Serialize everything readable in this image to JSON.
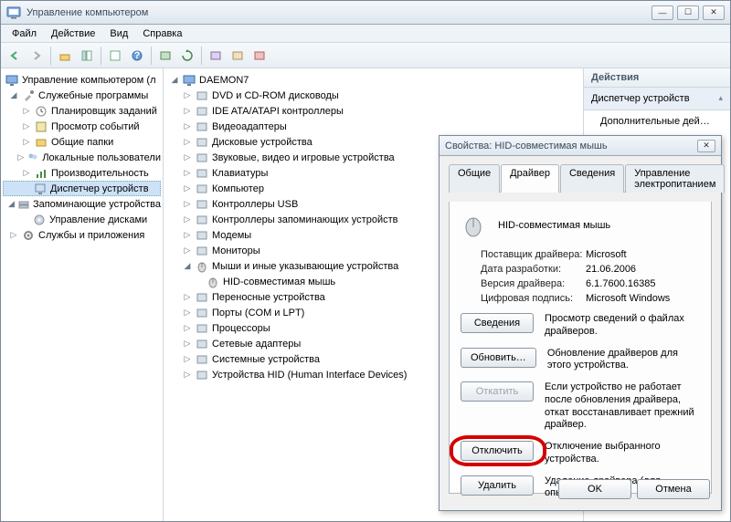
{
  "window": {
    "title": "Управление компьютером"
  },
  "menu": {
    "file": "Файл",
    "action": "Действие",
    "view": "Вид",
    "help": "Справка"
  },
  "left_tree": {
    "root": "Управление компьютером (л",
    "sys_tools": "Служебные программы",
    "task_sched": "Планировщик заданий",
    "event_viewer": "Просмотр событий",
    "shared": "Общие папки",
    "local_users": "Локальные пользователи",
    "perf": "Производительность",
    "devmgr": "Диспетчер устройств",
    "storage": "Запоминающие устройства",
    "diskmgr": "Управление дисками",
    "services": "Службы и приложения"
  },
  "mid_tree": {
    "root": "DAEMON7",
    "items": [
      "DVD и CD-ROM дисководы",
      "IDE ATA/ATAPI контроллеры",
      "Видеоадаптеры",
      "Дисковые устройства",
      "Звуковые, видео и игровые устройства",
      "Клавиатуры",
      "Компьютер",
      "Контроллеры USB",
      "Контроллеры запоминающих устройств",
      "Модемы",
      "Мониторы"
    ],
    "mice": "Мыши и иные указывающие устройства",
    "hid_mouse": "HID-совместимая мышь",
    "items2": [
      "Переносные устройства",
      "Порты (COM и LPT)",
      "Процессоры",
      "Сетевые адаптеры",
      "Системные устройства",
      "Устройства HID (Human Interface Devices)"
    ]
  },
  "right_pane": {
    "header": "Действия",
    "sub": "Диспетчер устройств",
    "extra": "Дополнительные дей…"
  },
  "dialog": {
    "title": "Свойства: HID-совместимая мышь",
    "tabs": {
      "general": "Общие",
      "driver": "Драйвер",
      "details": "Сведения",
      "power": "Управление электропитанием"
    },
    "device_name": "HID-совместимая мышь",
    "info": {
      "provider_l": "Поставщик драйвера:",
      "provider_v": "Microsoft",
      "date_l": "Дата разработки:",
      "date_v": "21.06.2006",
      "ver_l": "Версия драйвера:",
      "ver_v": "6.1.7600.16385",
      "sig_l": "Цифровая подпись:",
      "sig_v": "Microsoft Windows"
    },
    "buttons": {
      "details": "Сведения",
      "details_d": "Просмотр сведений о файлах драйверов.",
      "update": "Обновить…",
      "update_d": "Обновление драйверов для этого устройства.",
      "rollback": "Откатить",
      "rollback_d": "Если устройство не работает после обновления драйвера, откат восстанавливает прежний драйвер.",
      "disable": "Отключить",
      "disable_d": "Отключение выбранного устройства.",
      "remove": "Удалить",
      "remove_d": "Удаление драйвера (для опытных).",
      "ok": "OK",
      "cancel": "Отмена"
    }
  }
}
